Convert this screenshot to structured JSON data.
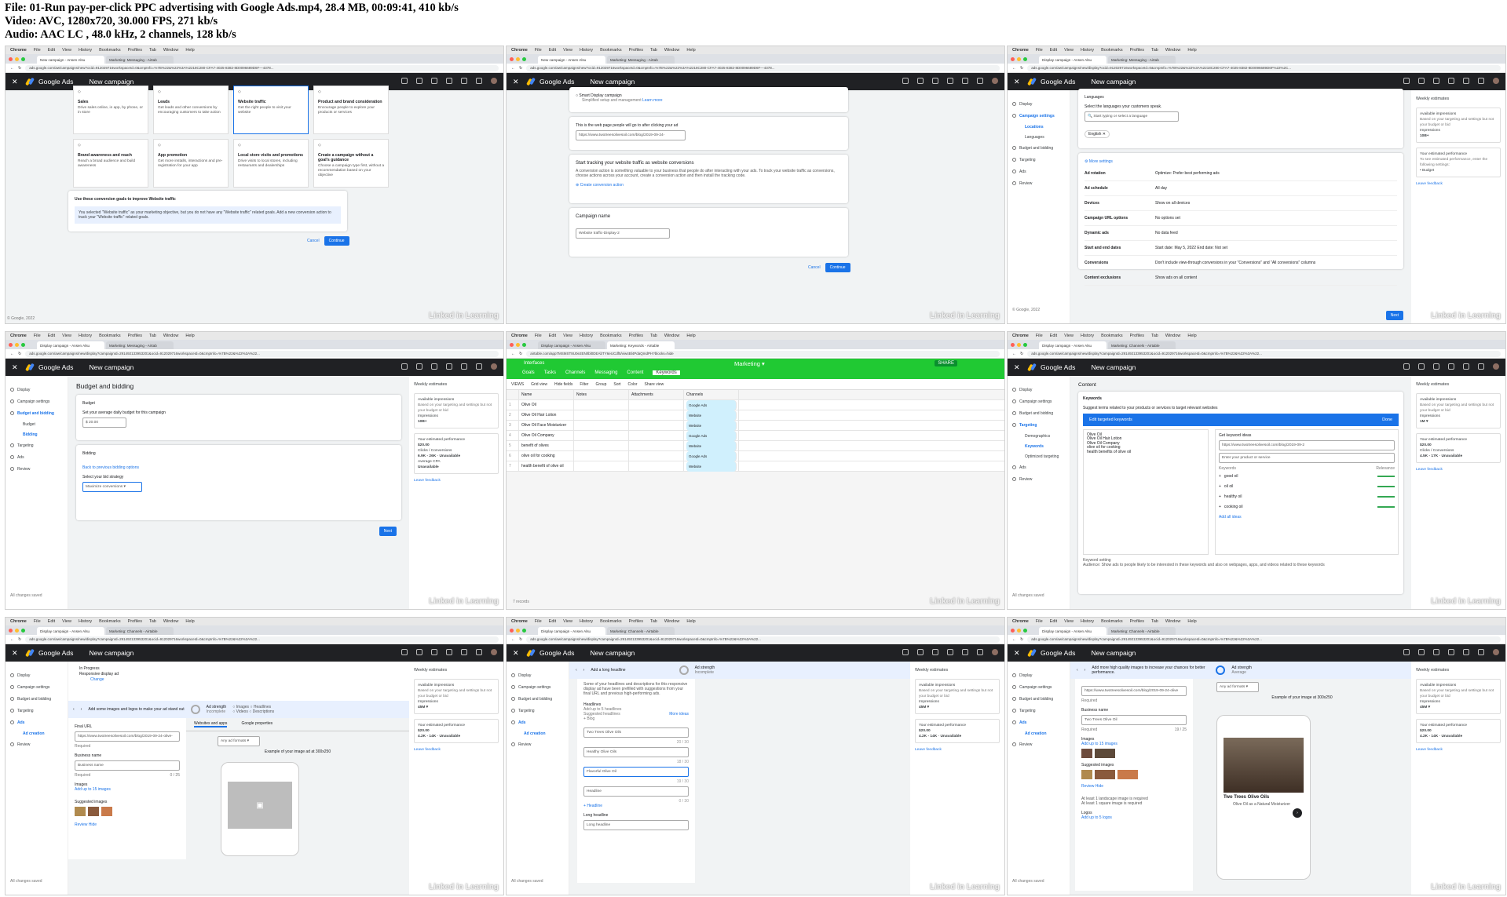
{
  "header": {
    "line1": "File: 01-Run pay-per-click PPC advertising with Google Ads.mp4, 28.4 MB, 00:09:41, 410 kb/s",
    "line2": "Video: AVC, 1280x720, 30.000 FPS, 271 kb/s",
    "line3": "Audio: AAC LC , 48.0 kHz, 2 channels, 128 kb/s"
  },
  "chrome": {
    "menu": [
      "Chrome",
      "File",
      "Edit",
      "View",
      "History",
      "Bookmarks",
      "Profiles",
      "Tab",
      "Window",
      "Help"
    ]
  },
  "watermark": "Linked in Learning",
  "ga": {
    "brand": "Google Ads",
    "page": "New campaign"
  },
  "t1": {
    "tab1": "New campaign - Ansen Alsu",
    "tab2": "Marketing: Messaging - Airtab",
    "url": "ads.google.com/aw/campaigns/new?ocid=912029716workspaceId=0&cmpInfo=%7B%22&%22%3A%2218C280-CFA7-4025-8382-8D0096689D6F—4378...",
    "objectives": [
      {
        "t": "Sales",
        "d": "Drive sales online, in app, by phone, or in store"
      },
      {
        "t": "Leads",
        "d": "Get leads and other conversions by encouraging customers to take action"
      },
      {
        "t": "Website traffic",
        "d": "Get the right people to visit your website"
      },
      {
        "t": "Product and brand consideration",
        "d": "Encourage people to explore your products or services"
      },
      {
        "t": "Brand awareness and reach",
        "d": "Reach a broad audience and build awareness"
      },
      {
        "t": "App promotion",
        "d": "Get more installs, interactions and pre-registration for your app"
      },
      {
        "t": "Local store visits and promotions",
        "d": "Drive visits to local stores, including restaurants and dealerships"
      },
      {
        "t": "Create a campaign without a goal's guidance",
        "d": "Choose a campaign type first, without a recommendation based on your objective"
      }
    ],
    "goals_title": "Use these conversion goals to improve Website traffic",
    "goals_info": "You selected \"Website traffic\" as your marketing objective, but you do not have any \"Website traffic\" related goals. Add a new conversion action to track your \"Website traffic\" related goals.",
    "cancel": "Cancel",
    "continue": "Continue",
    "copyright": "© Google, 2022"
  },
  "t2": {
    "smart": "Smart Display campaign",
    "smart_sub": "Simplified setup and management",
    "learn": "Learn more",
    "page_label": "This is the web page people will go to after clicking your ad",
    "page_url": "https://www.twotreesolivesoil.com/blog/2019-09-24-",
    "track_title": "Start tracking your website traffic as website conversions",
    "track_desc": "A conversion action is something valuable to your business that people do after interacting with your ads. To track your website traffic as conversions, choose actions across your account, create a conversion action and then install the tracking code.",
    "create": "Create conversion action",
    "name_title": "Campaign name",
    "name_val": "Website traffic-Display-2",
    "cancel": "Cancel",
    "continue": "Continue"
  },
  "t3": {
    "tab1": "Display campaign - Ansen Alsu",
    "tab2": "Marketing: Messaging - Airtab",
    "url": "ads.google.com/aw/campaigns/new/display?ocid=912029716workspaceId=0&cmpInfo=%7B%22&%22%3A%2218C280-CFA7-4025-8382-8D0096689D6F%22%2C...",
    "side": [
      "Display",
      "Campaign settings",
      "Locations",
      "Languages",
      "Budget and bidding",
      "Targeting",
      "Ads",
      "Review"
    ],
    "lang_head": "Languages",
    "lang_label": "Select the languages your customers speak.",
    "lang_ph": "Start typing or select a language",
    "lang_chip": "English",
    "more": "More settings",
    "settings": [
      [
        "Ad rotation",
        "Optimize: Prefer best performing ads"
      ],
      [
        "Ad schedule",
        "All day"
      ],
      [
        "Devices",
        "Show on all devices"
      ],
      [
        "Campaign URL options",
        "No options set"
      ],
      [
        "Dynamic ads",
        "No data feed"
      ],
      [
        "Start and end dates",
        "Start date: May 5, 2022     End date: Not set"
      ],
      [
        "Conversions",
        "Don't include view-through conversions in your \"Conversions\" and \"All conversions\" columns"
      ],
      [
        "Content exclusions",
        "Show ads on all content"
      ]
    ],
    "next": "Next",
    "est_title": "Weekly estimates",
    "est_imp": "Available impressions",
    "est_imp_desc": "Based on your targeting and settings but not your budget or bid",
    "est_imp_label": "Impressions",
    "est_imp_val": "10B+",
    "est_perf": "Your estimated performance",
    "est_perf_desc": "To see estimated performance, enter the following settings:",
    "est_perf_item": "Budget",
    "feedback": "Leave feedback"
  },
  "t4": {
    "tab1": "Display campaign - Ansen Alsu",
    "tab2": "Marketing: Messaging - Airtab",
    "url": "ads.google.com/aw/campaigns/new/display?campaignId=291492133953201&ocid=912029716workspaceId=0&cmpInfo=%7B%22&%22%3A%22...",
    "title": "Budget and bidding",
    "budget_head": "Budget",
    "budget_label": "Set your average daily budget for this campaign",
    "budget_val": "$ 20.00",
    "bidding_head": "Bidding",
    "back_link": "Back to previous bidding options",
    "focus_label": "Select your bid strategy",
    "strategy": "Maximize conversions",
    "next": "Next",
    "saved": "All changes saved",
    "est_title": "Weekly estimates",
    "imp": "Available impressions",
    "imp_label": "Impressions",
    "imp_val": "10B+",
    "perf": "Your estimated performance",
    "budget_line": "$20.00",
    "clicks": "Clicks",
    "clicks_val": "6.9K - 26K",
    "conv": "Conversions",
    "conv_val": "Unavailable",
    "cpa": "Average CPA",
    "cpa_val": "Unavailable",
    "feedback": "Leave feedback"
  },
  "t5": {
    "tab1": "Display campaign - Ansen Alsu",
    "tab2": "Marketing: Keywords - Airtable",
    "url": "airtable.com/app7MSMST8U0e2EN/tbl0DEAbTY6eUCdf5/viw4Bl4PdaQmdPH?blocks=hide",
    "base": "Interfaces",
    "title": "Marketing",
    "share": "SHARE",
    "tabs": [
      "Goals",
      "Tasks",
      "Channels",
      "Messaging",
      "Content",
      "Keywords"
    ],
    "toolbar": [
      "VIEWS",
      "Grid view",
      "Hide fields",
      "Filter",
      "Group",
      "Sort",
      "Color",
      "Share view"
    ],
    "cols": [
      "Name",
      "Notes",
      "Attachments",
      "Channels"
    ],
    "rows": [
      {
        "n": "Olive Oil",
        "c": [
          "Google Ads"
        ]
      },
      {
        "n": "Olive Oil Hair Lotion",
        "c": [
          "Website",
          "Google Ads"
        ]
      },
      {
        "n": "Olive Oil Face Moisturizer",
        "c": [
          "Website"
        ]
      },
      {
        "n": "Olive Oil Company",
        "c": [
          "Google Ads"
        ]
      },
      {
        "n": "benefit of olives",
        "c": [
          "Website"
        ]
      },
      {
        "n": "olive oil for cooking",
        "c": [
          "Google Ads"
        ]
      },
      {
        "n": "health benefit of olive oil",
        "c": [
          "Website",
          "Google Ads"
        ]
      }
    ],
    "records": "7 records"
  },
  "t6": {
    "side": [
      "Display",
      "Campaign settings",
      "Budget and bidding",
      "Targeting",
      "Demographics",
      "Keywords",
      "Optimized targeting",
      "Ads",
      "Review"
    ],
    "content": "Content",
    "kw": "Keywords",
    "kw_desc": "Suggest terms related to your products or services to target relevant websites",
    "edit": "Edit targeted keywords",
    "done": "Done",
    "list": [
      "Olive Oil",
      "Olive Oil Hair Lotion",
      "Olive Oil Company",
      "olive oil for cooking",
      "health benefits of olive oil"
    ],
    "ideas": "Get keyword ideas",
    "ideas_url": "https://www.twotreesolivesoil.com/blog/2019-09-2",
    "ideas_ph": "Enter your product or service",
    "k_head": "Keywords",
    "r_head": "Relevance",
    "kws": [
      "good oil",
      "oil oil",
      "healthy oil",
      "cooking oil"
    ],
    "addall": "Add all ideas",
    "setting": "Keyword setting",
    "audience": "Audience: Show ads to people likely to be interested in these keywords and also on webpages, apps, and videos related to these keywords",
    "imp_val": "1M ▾",
    "perf": "Your estimated performance",
    "clicks_val": "4.5K - 17K",
    "conv_val": "Unavailable",
    "saved": "All changes saved"
  },
  "t7": {
    "tab1": "Display campaign - Ansen Alsu",
    "tab2": "Marketing: Channels - Airtable",
    "side": [
      "Display",
      "Campaign settings",
      "Budget and bidding",
      "Targeting",
      "Ads",
      "Ad creation",
      "Review"
    ],
    "status": "In Progress",
    "type": "Responsive display ad",
    "change": "Change",
    "ad_hint": "Add some images and logos to make your ad stand out",
    "strength": "Ad strength",
    "strength_val": "Incomplete",
    "checks": [
      "Images",
      "Videos",
      "Headlines",
      "Descriptions"
    ],
    "final": "Final URL",
    "final_val": "https://www.twotreesolivesoil.com/blog/2019-09-24-olive-",
    "required": "Required",
    "biz": "Business name",
    "biz_ph": "Business name",
    "count": "0 / 25",
    "images": "Images",
    "images_add": "Add up to 15 images",
    "suggested": "Suggested images",
    "review": "Review",
    "hide": "Hide",
    "preview_tabs": [
      "Websites and apps",
      "Google properties"
    ],
    "format": "Any ad formats",
    "example": "Example of your image ad at 300x250",
    "imp_val": "45M ▾",
    "clicks_val": "4.2K - 14K",
    "conv_val": "Unavailable"
  },
  "t8": {
    "add_headline": "Add a long headline",
    "strength": "Ad strength",
    "strength_val": "Incomplete",
    "headlines_desc": "Some of your headlines and descriptions for this responsive display ad have been prefilled with suggestions from your final URL and previous high-performing ads.",
    "headlines": "Headlines",
    "headlines_add": "Add up to 5 headlines",
    "suggested_h": "Suggested headlines",
    "blog": "Blog",
    "more": "More ideas",
    "h1": "Two Trees Olive Oils",
    "h2": "Healthy Olive Oils",
    "h3": "Flavorful Olive Oil",
    "h4": "Headline",
    "add_h": "Headline",
    "long": "Long headline",
    "long_ph": "Long headline",
    "c1": "20 / 30",
    "c2": "18 / 30",
    "c3": "19 / 30",
    "c4": "0 / 30"
  },
  "t9": {
    "hint": "Add more high quality images to increase your chances for better performance.",
    "strength": "Ad strength",
    "strength_val": "Average",
    "url": "https://www.twotreesolivesoil.com/blog/2019-09-24-olive",
    "biz": "Business name",
    "biz_val": "Two Trees Olive Oil",
    "count": "19 / 25",
    "images": "Images",
    "images_add": "Add up to 15 images",
    "logos": "Logos",
    "logos_add": "Add up to 5 logos",
    "req1": "At least 1 landscape image is required",
    "req2": "At least 1 square image is required",
    "preview_title": "Two Trees Olive Oils",
    "preview_desc": "Olive Oil as a Natural Moisturizer",
    "example": "Example of your image at 300x250",
    "format": "Any ad formats"
  }
}
